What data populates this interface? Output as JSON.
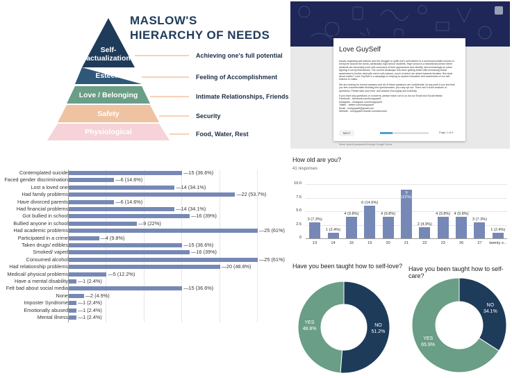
{
  "maslow": {
    "title_line1": "MASLOW'S",
    "title_line2": "HIERARCHY OF NEEDS",
    "levels": [
      {
        "label1": "Self-",
        "label2": "actualization",
        "need": "Achieving one's full potential",
        "color": "#1f3b5a"
      },
      {
        "label1": "Esteem",
        "label2": "",
        "need": "Feeling of Accomplishment",
        "color": "#2f5878"
      },
      {
        "label1": "Love / Belonging",
        "label2": "",
        "need": "Intimate Relationships, Friends",
        "color": "#6a9e86"
      },
      {
        "label1": "Safety",
        "label2": "",
        "need": "Security",
        "color": "#efc3a2"
      },
      {
        "label1": "Physiological",
        "label2": "",
        "need": "Food, Water, Rest",
        "color": "#f5d3d8"
      }
    ],
    "arrow_color": "#f2a26b"
  },
  "form": {
    "title": "Love GuySelf",
    "body_p1": "Issues regarding self-esteem and the struggle to uplift one's self-esteem is a universal problem known to everyone around the world, particularly high school students. High school is a transitional period where students are becoming more self-conscious of their appearance and identity, and increasingly so when figuring it out by themselves. The current landscape has been getting better with increasing social awareness to further deal with men's self-esteem, much of which are aimed towards females. But what about males? Love GuySelf is a campaign in helping to expand education and awareness of our self-esteem in males.",
    "body_p2": "We are looking for honest answers and all of these questions are confidential. At any point if you feel that you feel uncomfortable finishing this questionnaire, you may opt out. There are 5 short sections of questions. Please take your time, and answer thoroughly and truthfully.",
    "body_p3": "If you have any questions or concerns, please reach out to us via our Email and Social Media:",
    "contacts": [
      "Facebook - facebook.com/loveguyself",
      "Instagram - instagram.com/loveguyself",
      "Twitter - twitter.com/loveguyself",
      "Email - loveguyself@gmail.com",
      "Website - loveguyself.wixsite.com/welcome"
    ],
    "next_label": "NEXT",
    "progress": 0.25,
    "page_label": "Page 1 of 6",
    "footer": "Never submit passwords through Google Forms."
  },
  "hbar_chart": {
    "chart_data": {
      "type": "bar",
      "orientation": "horizontal",
      "categories": [
        "Contemplated suicide",
        "Faced gender discrimination",
        "Lost a loved one",
        "Had family problems",
        "Have divorced parents",
        "Had financial problems",
        "Got bullied in school",
        "Bullied anyone in school",
        "Had academic problems",
        "Participated in a crime",
        "Taken drugs/ edibles",
        "Smoked/ vaped",
        "Consumed alcohol",
        "Had relationship problems",
        "Medical/ physical problems",
        "Have a mental disability",
        "Felt bad about social media",
        "None",
        "Imposter Syndrome",
        "Emotionally abused",
        "Mental illness"
      ],
      "values": [
        15,
        6,
        14,
        22,
        6,
        14,
        16,
        9,
        25,
        4,
        15,
        16,
        25,
        20,
        5,
        1,
        15,
        2,
        1,
        1,
        1
      ],
      "labels": [
        "15 (36.6%)",
        "6 (14.6%)",
        "14 (34.1%)",
        "22 (53.7%)",
        "6 (14.6%)",
        "14 (34.1%)",
        "16 (39%)",
        "9 (22%)",
        "25 (61%)",
        "4 (9.8%)",
        "15 (36.6%)",
        "16 (39%)",
        "25 (61%)",
        "20 (48.8%)",
        "5 (12.2%)",
        "1 (2.4%)",
        "15 (36.6%)",
        "2 (4.9%)",
        "1 (2.4%)",
        "1 (2.4%)",
        "1 (2.4%)"
      ],
      "xlim": [
        0,
        25
      ],
      "color": "#7688b5"
    }
  },
  "age_chart": {
    "question": "How old are you?",
    "responses": "41 responses",
    "chart_data": {
      "type": "bar",
      "categories": [
        "13",
        "14",
        "16",
        "19",
        "20",
        "21",
        "22",
        "23",
        "26",
        "27",
        "twenty s..."
      ],
      "values": [
        3,
        1,
        4,
        6,
        4,
        9,
        2,
        4,
        4,
        3,
        1
      ],
      "labels": [
        [
          "3 (7.3%)"
        ],
        [
          "1 (2.4%)"
        ],
        [
          "4 (9.8%)"
        ],
        [
          "6 (14.6%)"
        ],
        [
          "4 (9.8%)"
        ],
        [
          "9",
          "(22%)"
        ],
        [
          "2 (4.9%)"
        ],
        [
          "4 (9.8%)"
        ],
        [
          "4 (9.8%)"
        ],
        [
          "3 (7.3%)"
        ],
        [
          "1 (2.4%)"
        ]
      ],
      "yticks": [
        "0",
        "2.5",
        "5.0",
        "7.5",
        "10.0"
      ],
      "ylim": [
        0,
        10
      ],
      "color": "#7688b5"
    }
  },
  "selflove": {
    "question": "Have you been taught how to self-love?",
    "chart_data": {
      "type": "pie",
      "slices": [
        {
          "label": "NO",
          "pct_label": "51.2%",
          "value": 51.2,
          "color": "#1f3b5a"
        },
        {
          "label": "YES",
          "pct_label": "48.8%",
          "value": 48.8,
          "color": "#6a9e86"
        }
      ]
    }
  },
  "selfcare": {
    "question": "Have you been taught how to self-care?",
    "chart_data": {
      "type": "pie",
      "slices": [
        {
          "label": "NO",
          "pct_label": "34.1%",
          "value": 34.1,
          "color": "#1f3b5a"
        },
        {
          "label": "YES",
          "pct_label": "65.9%",
          "value": 65.9,
          "color": "#6a9e86"
        }
      ]
    }
  }
}
